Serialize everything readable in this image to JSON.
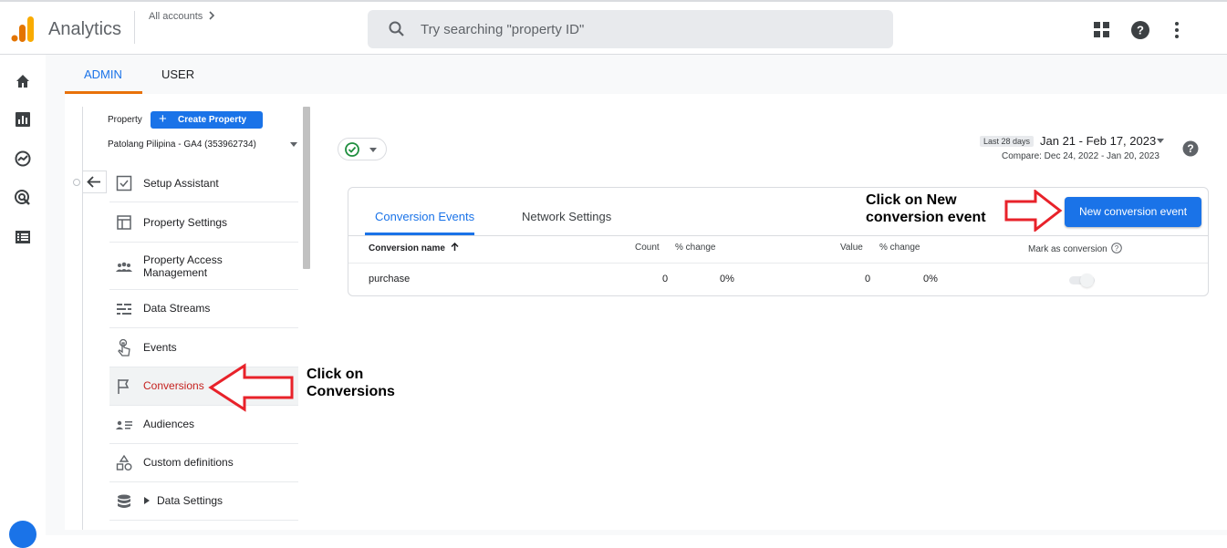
{
  "header": {
    "app_name": "Analytics",
    "accounts_label": "All accounts",
    "search_placeholder": "Try searching \"property ID\""
  },
  "top_icons": [
    "apps-grid-icon",
    "help-icon",
    "more-vert-icon"
  ],
  "left_nav": [
    "home-icon",
    "reports-icon",
    "explore-icon",
    "advertising-icon",
    "configure-icon"
  ],
  "tabs": {
    "admin": "ADMIN",
    "user": "USER"
  },
  "property": {
    "label": "Property",
    "create_label": "Create Property",
    "selected": "Patolang Pilipina - GA4 (353962734)"
  },
  "menu": [
    {
      "label": "Setup Assistant",
      "icon": "checklist-icon"
    },
    {
      "label": "Property Settings",
      "icon": "window-icon"
    },
    {
      "label": "Property Access Management",
      "icon": "people-icon"
    },
    {
      "label": "Data Streams",
      "icon": "streams-icon"
    },
    {
      "label": "Events",
      "icon": "touch-icon"
    },
    {
      "label": "Conversions",
      "icon": "flag-icon",
      "active": true
    },
    {
      "label": "Audiences",
      "icon": "audience-icon"
    },
    {
      "label": "Custom definitions",
      "icon": "shapes-icon"
    },
    {
      "label": "Data Settings",
      "icon": "database-icon"
    }
  ],
  "annotations": {
    "conversions": "Click on Conversions",
    "new_event": "Click on New conversion event"
  },
  "date": {
    "chip": "Last 28 days",
    "range": "Jan 21 - Feb 17, 2023",
    "compare": "Compare: Dec 24, 2022 - Jan 20, 2023"
  },
  "card": {
    "tabs": [
      "Conversion Events",
      "Network Settings"
    ],
    "new_button": "New conversion event",
    "columns": {
      "name": "Conversion name",
      "count": "Count",
      "count_change": "% change",
      "value": "Value",
      "value_change": "% change",
      "mark": "Mark as conversion"
    },
    "rows": [
      {
        "name": "purchase",
        "count": "0",
        "count_change": "0%",
        "value": "0",
        "value_change": "0%"
      }
    ]
  },
  "colors": {
    "accent": "#1a73e8",
    "active_text": "#c5221f",
    "arrow": "#e8222a",
    "tab_underline": "#e8710a"
  }
}
